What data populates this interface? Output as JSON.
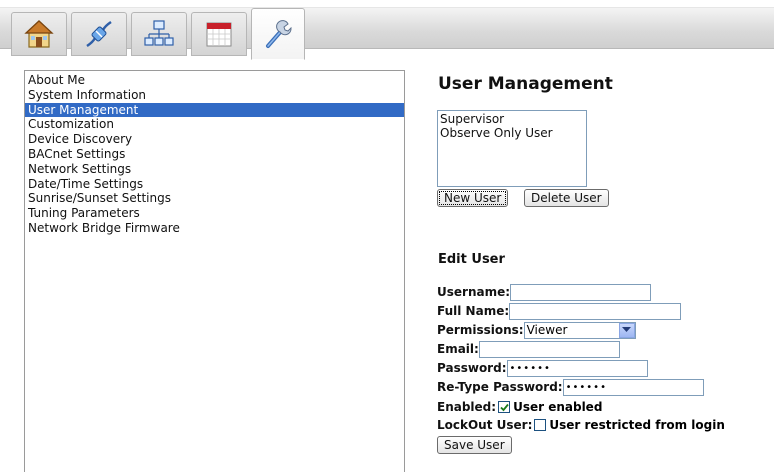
{
  "toolbar": {
    "tabs": [
      {
        "icon": "home-icon"
      },
      {
        "icon": "network-plug-icon"
      },
      {
        "icon": "network-tree-icon"
      },
      {
        "icon": "calendar-icon"
      },
      {
        "icon": "wrench-icon",
        "active": true
      }
    ]
  },
  "sidebar": {
    "items": [
      {
        "label": "About Me"
      },
      {
        "label": "System Information"
      },
      {
        "label": "User Management",
        "selected": true
      },
      {
        "label": "Customization"
      },
      {
        "label": "Device Discovery"
      },
      {
        "label": "BACnet Settings"
      },
      {
        "label": "Network Settings"
      },
      {
        "label": "Date/Time Settings"
      },
      {
        "label": "Sunrise/Sunset Settings"
      },
      {
        "label": "Tuning Parameters"
      },
      {
        "label": "Network Bridge Firmware"
      }
    ]
  },
  "main": {
    "title": "User Management",
    "users": [
      "Supervisor",
      "Observe Only User"
    ],
    "new_user_label": "New User",
    "delete_user_label": "Delete User",
    "edit_title": "Edit User",
    "form": {
      "username_label": "Username:",
      "username_value": "",
      "fullname_label": "Full Name:",
      "fullname_value": "",
      "permissions_label": "Permissions:",
      "permissions_value": "Viewer",
      "email_label": "Email:",
      "email_value": "",
      "password_label": "Password:",
      "password_value": "••••••",
      "retype_label": "Re-Type Password:",
      "retype_value": "••••••",
      "enabled_label": "Enabled:",
      "enabled_checked": true,
      "enabled_text": "User enabled",
      "lockout_label": "LockOut User:",
      "lockout_checked": false,
      "lockout_text": "User restricted from login",
      "save_label": "Save User"
    }
  },
  "colors": {
    "selection": "#316ac5",
    "input_border": "#7f9db9"
  }
}
